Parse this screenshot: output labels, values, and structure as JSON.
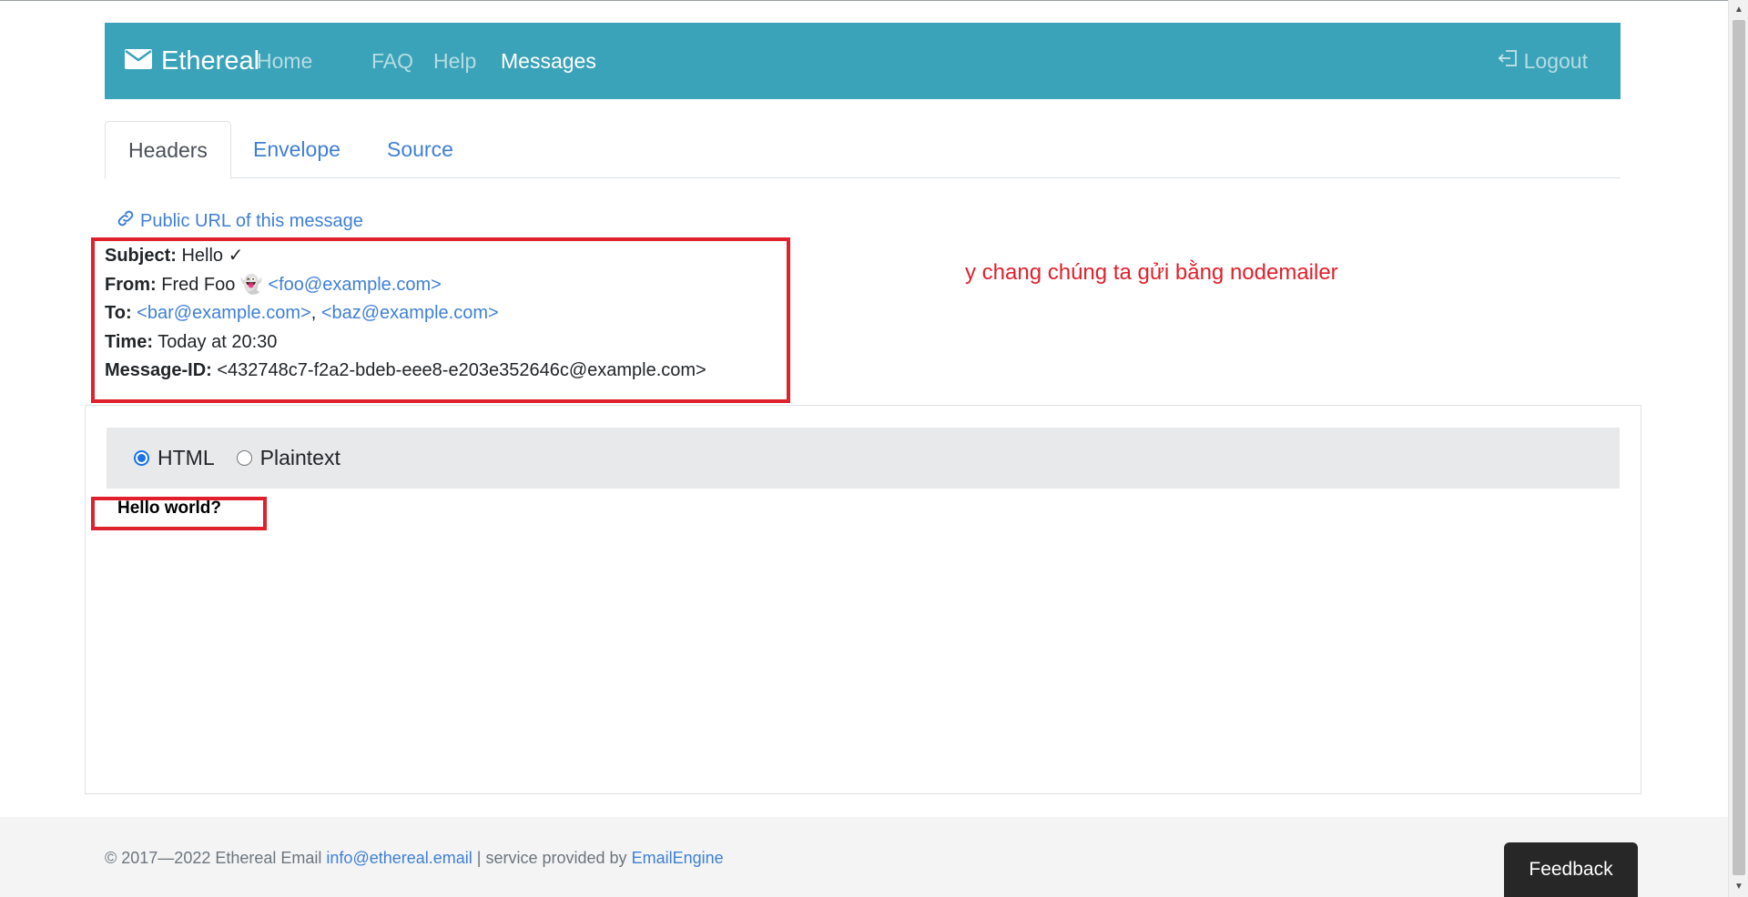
{
  "navbar": {
    "brand": "Ethereal",
    "links": [
      "Home",
      "FAQ",
      "Help",
      "Messages"
    ],
    "active": "Messages",
    "logout": "Logout",
    "bg_color": "#3ba3b9"
  },
  "tabs": [
    {
      "label": "Headers",
      "active": true
    },
    {
      "label": "Envelope",
      "active": false
    },
    {
      "label": "Source",
      "active": false
    }
  ],
  "public_url_label": "Public URL of this message",
  "headers": {
    "subject_label": "Subject:",
    "subject_value": "Hello ✓",
    "from_label": "From:",
    "from_name": "Fred Foo 👻",
    "from_email": "<foo@example.com>",
    "to_label": "To:",
    "to_email_1": "<bar@example.com>",
    "to_sep": ",",
    "to_email_2": "<baz@example.com>",
    "time_label": "Time:",
    "time_value": "Today at 20:30",
    "message_id_label": "Message-ID:",
    "message_id_value": "<432748c7-f2a2-bdeb-eee8-e203e352646c@example.com>"
  },
  "annotation": "y chang chúng ta gửi bằng nodemailer",
  "view_options": {
    "html_label": "HTML",
    "plaintext_label": "Plaintext",
    "selected": "HTML"
  },
  "message_body": "Hello world?",
  "footer": {
    "copyright": "© 2017—2022 Ethereal Email",
    "contact_email": "info@ethereal.email",
    "service_text": "| service provided by",
    "provider": "EmailEngine"
  },
  "feedback_label": "Feedback",
  "colors": {
    "link": "#3f7fd6",
    "annotation_red": "#e0202c",
    "feedback_bg": "#272727"
  }
}
